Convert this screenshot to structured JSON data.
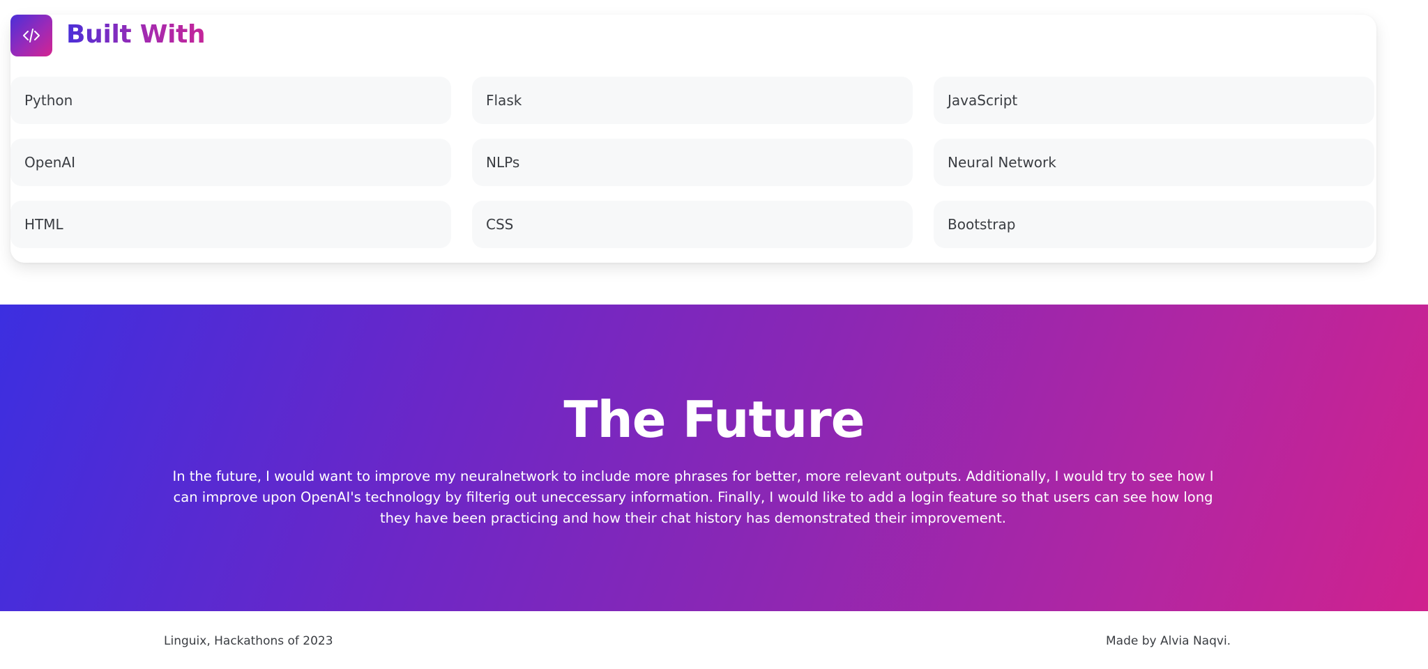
{
  "built_with": {
    "icon": "code-icon",
    "title": "Built With",
    "items": [
      {
        "label": "Python"
      },
      {
        "label": "Flask"
      },
      {
        "label": "JavaScript"
      },
      {
        "label": "OpenAI"
      },
      {
        "label": "NLPs"
      },
      {
        "label": "Neural Network"
      },
      {
        "label": "HTML"
      },
      {
        "label": "CSS"
      },
      {
        "label": "Bootstrap"
      }
    ]
  },
  "future": {
    "title": "The Future",
    "text": "In the future, I would want to improve my neuralnetwork to include more phrases for better, more relevant outputs. Additionally, I would try to see how I can improve upon OpenAI's technology by filterig out uneccessary information. Finally, I would like to add a login feature so that users can see how long they have been practicing and how their chat history has demonstrated their improvement."
  },
  "footer": {
    "left": "Linguix, Hackathons of 2023",
    "right": "Made by Alvia Naqvi."
  },
  "colors": {
    "gradient_start": "#3c2fe0",
    "gradient_end": "#d0228e",
    "card_item_bg": "#f7f8f9",
    "text_dark": "#3a3d42"
  }
}
